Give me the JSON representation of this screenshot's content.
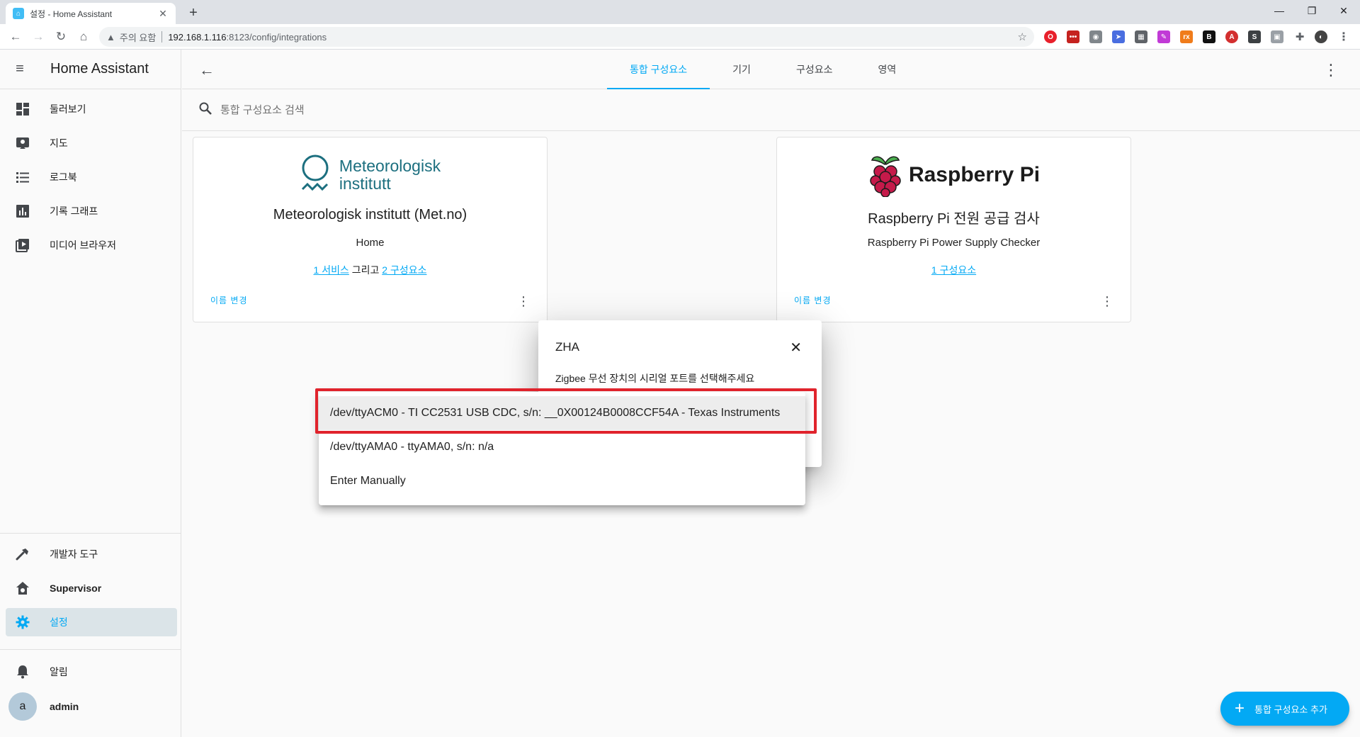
{
  "browser": {
    "tab_title": "설정 - Home Assistant",
    "new_tab": "+",
    "security_warning": "주의 요함",
    "url_host": "192.168.1.116",
    "url_path": ":8123/config/integrations"
  },
  "sidebar": {
    "title": "Home Assistant",
    "items": [
      {
        "label": "둘러보기",
        "icon": "dashboard-icon"
      },
      {
        "label": "지도",
        "icon": "map-icon"
      },
      {
        "label": "로그북",
        "icon": "logbook-icon"
      },
      {
        "label": "기록 그래프",
        "icon": "history-icon"
      },
      {
        "label": "미디어 브라우저",
        "icon": "media-icon"
      }
    ],
    "bottom_items": [
      {
        "label": "개발자 도구",
        "icon": "hammer-icon"
      },
      {
        "label": "Supervisor",
        "icon": "supervisor-icon"
      },
      {
        "label": "설정",
        "icon": "gear-icon"
      }
    ],
    "notifications": "알림",
    "user_initial": "a",
    "user_name": "admin"
  },
  "header": {
    "tabs": [
      "통합 구성요소",
      "기기",
      "구성요소",
      "영역"
    ],
    "active_tab": 0
  },
  "search": {
    "placeholder": "통합 구성요소 검색"
  },
  "cards": [
    {
      "logo_line1": "Meteorologisk",
      "logo_line2": "institutt",
      "name": "Meteorologisk institutt (Met.no)",
      "subtitle": "Home",
      "link1": "1 서비스",
      "link_join": "그리고",
      "link2": "2 구성요소",
      "rename": "이름 변경"
    },
    {
      "logo_text": "Raspberry Pi",
      "name": "Raspberry Pi 전원 공급 검사",
      "subtitle": "Raspberry Pi Power Supply Checker",
      "link1": "1 구성요소",
      "rename": "이름 변경"
    }
  ],
  "dialog": {
    "title": "ZHA",
    "description": "Zigbee 무선 장치의 시리얼 포트를 선택해주세요",
    "options": [
      "/dev/ttyACM0 - TI CC2531 USB CDC, s/n: __0X00124B0008CCF54A - Texas Instruments",
      "/dev/ttyAMA0 - ttyAMA0, s/n: n/a",
      "Enter Manually"
    ]
  },
  "fab": {
    "label": "통합 구성요소 추가"
  },
  "colors": {
    "accent": "#03a9f4",
    "highlight": "#e0232c",
    "met_teal": "#1c6f7f"
  }
}
